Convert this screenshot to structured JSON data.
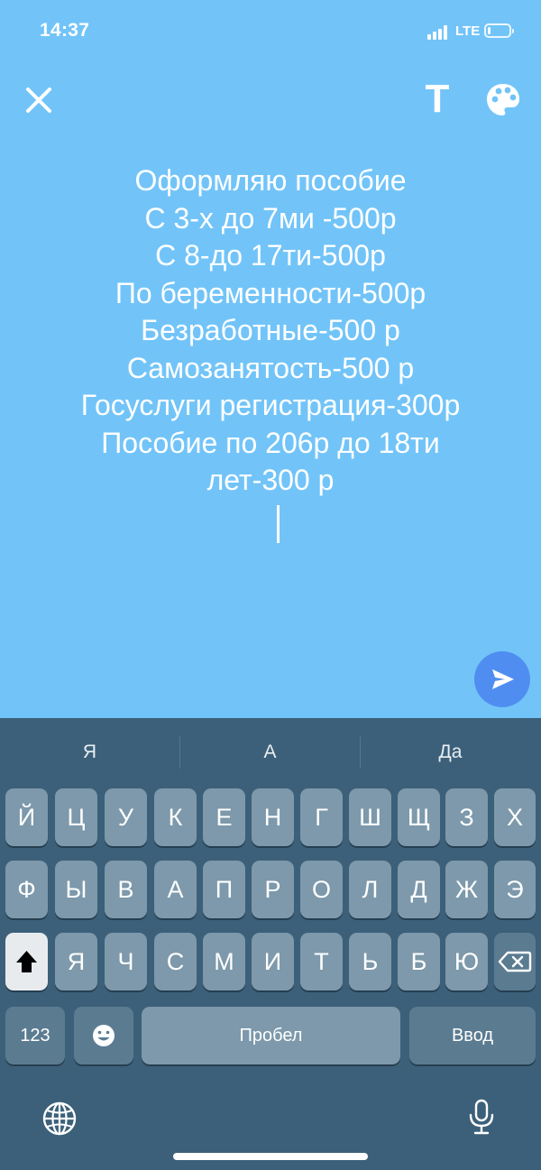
{
  "status_bar": {
    "time": "14:37",
    "network": "LTE",
    "signal_bars": 4,
    "battery_level": 0.15
  },
  "toolbar": {
    "close_icon": "close-icon",
    "text_style_label": "T",
    "palette_icon": "palette-icon"
  },
  "post": {
    "lines": [
      "Оформляю пособие",
      "С 3-х до 7ми -500р",
      "С 8-до 17ти-500р",
      "По беременности-500р",
      "Безработные-500 р",
      "Самозанятость-500 р",
      "Госуслуги регистрация-300р",
      "Пособие по 206р до 18ти",
      "лет-300 р"
    ],
    "background_color": "#72c4f8",
    "text_color": "#ffffff"
  },
  "send": {
    "icon": "send-icon",
    "color": "#4f8ef0"
  },
  "keyboard": {
    "suggestions": [
      "Я",
      "А",
      "Да"
    ],
    "row1": [
      "Й",
      "Ц",
      "У",
      "К",
      "Е",
      "Н",
      "Г",
      "Ш",
      "Щ",
      "З",
      "Х"
    ],
    "row2": [
      "Ф",
      "Ы",
      "В",
      "А",
      "П",
      "Р",
      "О",
      "Л",
      "Д",
      "Ж",
      "Э"
    ],
    "row3": [
      "Я",
      "Ч",
      "С",
      "М",
      "И",
      "Т",
      "Ь",
      "Б",
      "Ю"
    ],
    "numbers_label": "123",
    "space_label": "Пробел",
    "return_label": "Ввод",
    "background_color": "#3c6079"
  }
}
